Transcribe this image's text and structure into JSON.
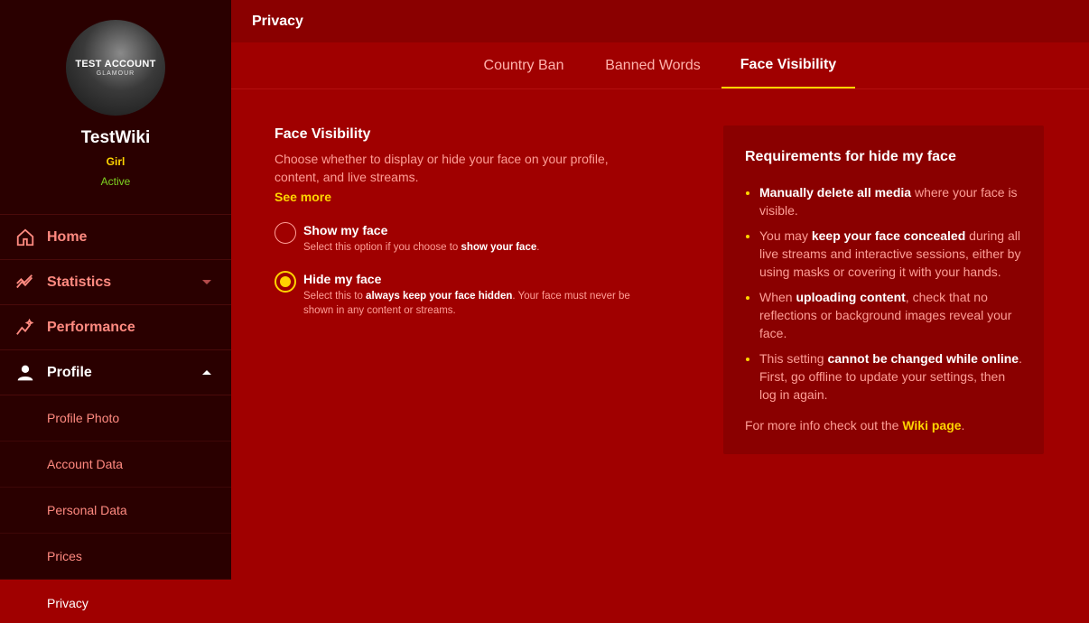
{
  "sidebar": {
    "avatar": {
      "title": "TEST ACCOUNT",
      "subtitle": "GLAMOUR"
    },
    "username": "TestWiki",
    "gender": "Girl",
    "status": "Active",
    "nav": {
      "home": "Home",
      "statistics": "Statistics",
      "performance": "Performance",
      "profile": "Profile"
    },
    "profile_items": [
      "Profile Photo",
      "Account Data",
      "Personal Data",
      "Prices",
      "Privacy"
    ]
  },
  "header": {
    "title": "Privacy"
  },
  "tabs": [
    "Country Ban",
    "Banned Words",
    "Face Visibility"
  ],
  "face_visibility": {
    "title": "Face Visibility",
    "description": "Choose whether to display or hide your face on your profile, content, and live streams.",
    "see_more": "See more",
    "options": [
      {
        "label": "Show my face",
        "desc_pre": "Select this option if you choose to ",
        "desc_bold": "show your face",
        "desc_post": ".",
        "checked": false
      },
      {
        "label": "Hide my face",
        "desc_pre": "Select this to ",
        "desc_bold": "always keep your face hidden",
        "desc_post": ". Your face must never be shown in any content or streams.",
        "checked": true
      }
    ]
  },
  "requirements": {
    "title": "Requirements for hide my face",
    "items": [
      {
        "pre": "",
        "bold": "Manually delete all media",
        "post": " where your face is visible."
      },
      {
        "pre": "You may ",
        "bold": "keep your face concealed",
        "post": " during all live streams and interactive sessions, either by using masks or covering it with your hands."
      },
      {
        "pre": "When ",
        "bold": "uploading content",
        "post": ", check that no reflections or background images reveal your face."
      },
      {
        "pre": "This setting ",
        "bold": "cannot be changed while online",
        "post": ". First, go offline to update your settings, then log in again."
      }
    ],
    "footer_pre": "For more info check out the ",
    "footer_link": "Wiki page",
    "footer_post": "."
  },
  "colors": {
    "accent": "#ffd400",
    "background": "#a00000",
    "sidebar": "#2a0000",
    "active_status": "#7ed321"
  }
}
